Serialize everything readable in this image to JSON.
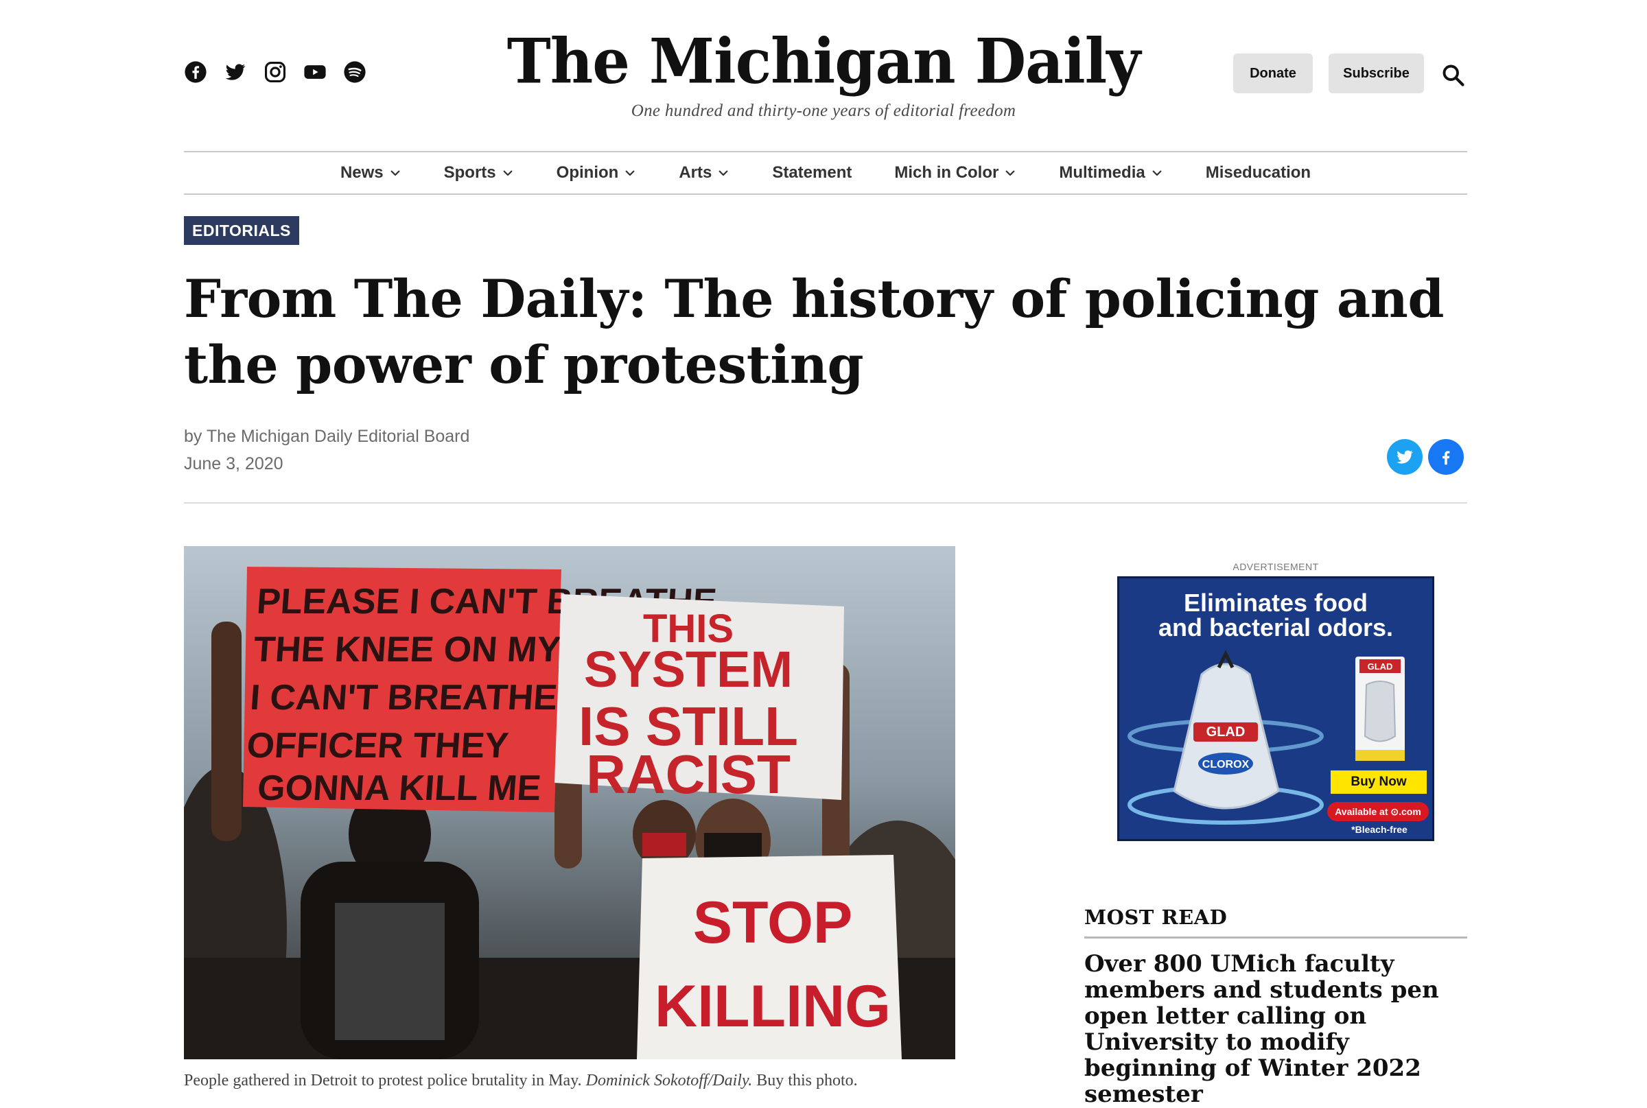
{
  "header": {
    "masthead": "The Michigan Daily",
    "tagline": "One hundred and thirty-one years of editorial freedom",
    "social_icons": [
      "facebook-icon",
      "twitter-icon",
      "instagram-icon",
      "youtube-icon",
      "spotify-icon"
    ],
    "donate_label": "Donate",
    "subscribe_label": "Subscribe"
  },
  "nav": {
    "items": [
      {
        "label": "News",
        "has_dropdown": true
      },
      {
        "label": "Sports",
        "has_dropdown": true
      },
      {
        "label": "Opinion",
        "has_dropdown": true
      },
      {
        "label": "Arts",
        "has_dropdown": true
      },
      {
        "label": "Statement",
        "has_dropdown": false
      },
      {
        "label": "Mich in Color",
        "has_dropdown": true
      },
      {
        "label": "Multimedia",
        "has_dropdown": true
      },
      {
        "label": "Miseducation",
        "has_dropdown": false
      }
    ]
  },
  "article": {
    "category": "EDITORIALS",
    "title": "From The Daily: The history of policing and the power of protesting",
    "byline_prefix": "by",
    "author": "The Michigan Daily Editorial Board",
    "date": "June 3, 2020",
    "share_icons": [
      "twitter-icon",
      "facebook-icon"
    ],
    "photo": {
      "signs": {
        "sign1": [
          "PLEASE I CAN'T BREATHE",
          "THE KNEE ON MY NECK",
          "I CAN'T BREATHE",
          "OFFICER THEY",
          "GONNA KILL ME"
        ],
        "sign2": [
          "THIS",
          "SYSTEM",
          "IS  STILL",
          "RACIST"
        ],
        "sign3": [
          "STOP",
          "KILLING"
        ]
      },
      "caption_text": "People gathered in Detroit to protest police brutality in May.",
      "caption_credit": "Dominick Sokotoff/Daily.",
      "caption_link": "Buy this photo."
    }
  },
  "sidebar": {
    "ad_label": "ADVERTISEMENT",
    "ad": {
      "headline_line1": "Eliminates food",
      "headline_line2": "and bacterial odors.",
      "cta": "Buy Now",
      "availability": "Available at ⊙.com",
      "fine_print": "*Bleach-free",
      "brand": "GLAD",
      "partner": "CLOROX"
    },
    "most_read_title": "MOST READ",
    "most_read_items": [
      "Over 800 UMich faculty members and students pen open letter calling on University to modify beginning of Winter 2022 semester"
    ]
  }
}
